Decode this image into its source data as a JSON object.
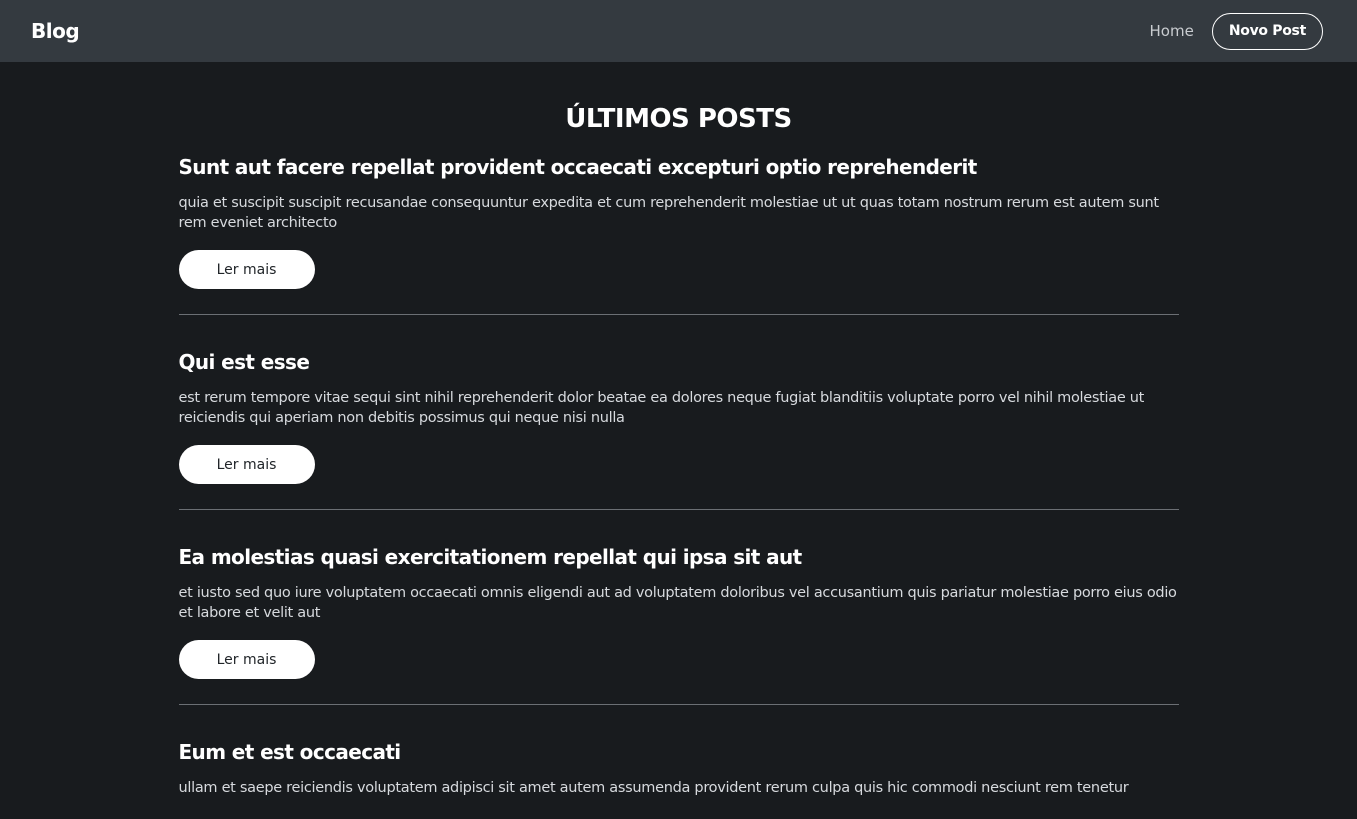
{
  "navbar": {
    "brand": "Blog",
    "home_label": "Home",
    "new_post_label": "Novo Post"
  },
  "main": {
    "title": "ÚLTIMOS POSTS",
    "read_more_label": "Ler mais",
    "posts": [
      {
        "title": "Sunt aut facere repellat provident occaecati excepturi optio reprehenderit",
        "body": "quia et suscipit suscipit recusandae consequuntur expedita et cum reprehenderit molestiae ut ut quas totam nostrum rerum est autem sunt rem eveniet architecto"
      },
      {
        "title": "Qui est esse",
        "body": "est rerum tempore vitae sequi sint nihil reprehenderit dolor beatae ea dolores neque fugiat blanditiis voluptate porro vel nihil molestiae ut reiciendis qui aperiam non debitis possimus qui neque nisi nulla"
      },
      {
        "title": "Ea molestias quasi exercitationem repellat qui ipsa sit aut",
        "body": "et iusto sed quo iure voluptatem occaecati omnis eligendi aut ad voluptatem doloribus vel accusantium quis pariatur molestiae porro eius odio et labore et velit aut"
      },
      {
        "title": "Eum et est occaecati",
        "body": "ullam et saepe reiciendis voluptatem adipisci sit amet autem assumenda provident rerum culpa quis hic commodi nesciunt rem tenetur"
      }
    ]
  },
  "colors": {
    "navbar_bg": "#343a40",
    "page_bg": "#181b1e",
    "divider": "#6b6f74"
  }
}
